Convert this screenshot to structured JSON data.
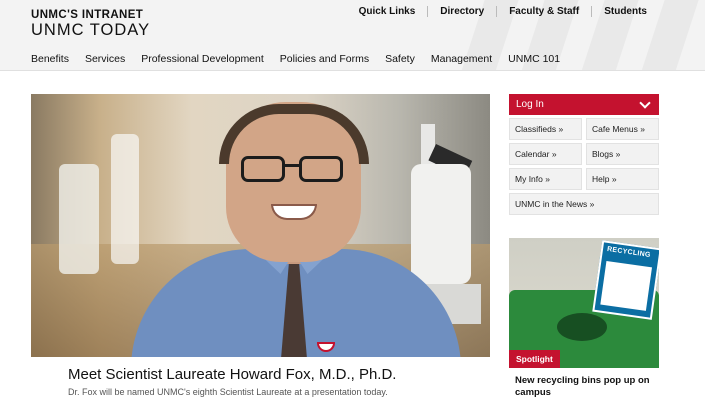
{
  "header": {
    "brand_top": "UNMC'S INTRANET",
    "brand_main": "UNMC TODAY",
    "top_links": [
      "Quick Links",
      "Directory",
      "Faculty & Staff",
      "Students"
    ],
    "nav": [
      "Benefits",
      "Services",
      "Professional Development",
      "Policies and Forms",
      "Safety",
      "Management",
      "UNMC 101"
    ]
  },
  "hero": {
    "title": "Meet Scientist Laureate Howard Fox, M.D., Ph.D.",
    "subtitle": "Dr. Fox will be named UNMC's eighth Scientist Laureate at a presentation today."
  },
  "sidebar": {
    "login_label": "Log In",
    "quick_links": [
      "Classifieds »",
      "Cafe Menus »",
      "Calendar »",
      "Blogs »",
      "My Info »",
      "Help »",
      "UNMC in the News »"
    ],
    "spotlight": {
      "badge": "Spotlight",
      "sign_text": "RECYCLING",
      "title": "New recycling bins pop up on campus"
    }
  },
  "colors": {
    "accent": "#c4122f",
    "header_bg": "#f3f3f3"
  }
}
